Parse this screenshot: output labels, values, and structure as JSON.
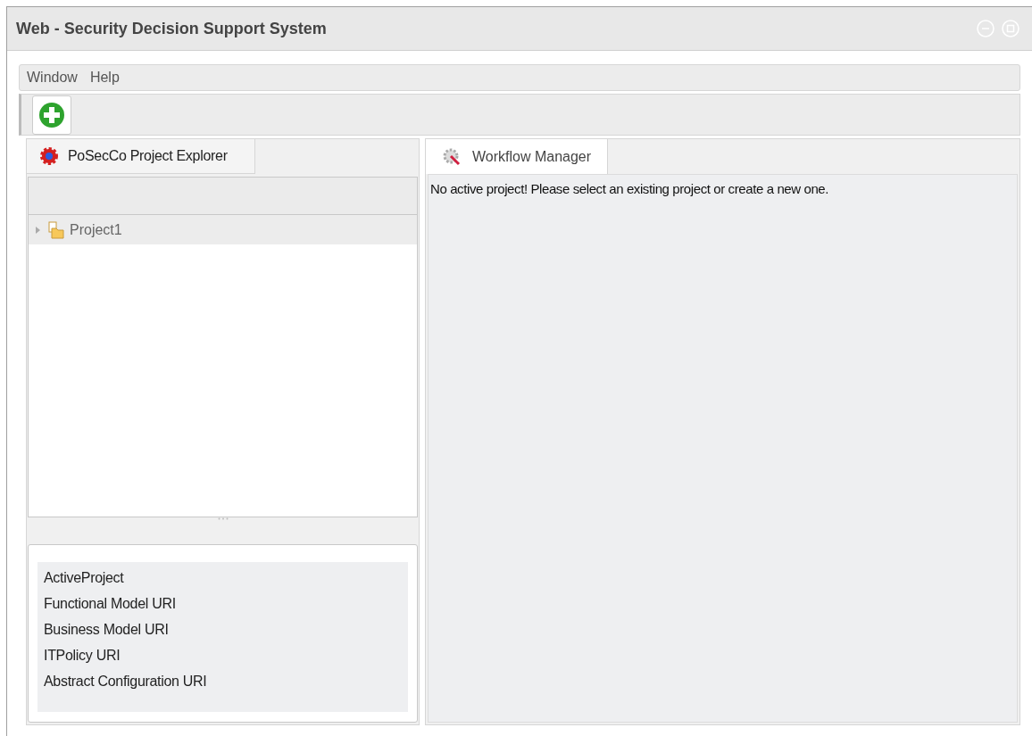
{
  "window": {
    "title": "Web - Security Decision Support System"
  },
  "menu": [
    "Window",
    "Help"
  ],
  "left_panel": {
    "tab": "PoSecCo Project Explorer",
    "tree": [
      {
        "label": "Project1",
        "expanded": false,
        "selected": true
      }
    ],
    "properties": [
      "ActiveProject",
      "Functional Model URI",
      "Business Model URI",
      "ITPolicy URI",
      "Abstract Configuration URI"
    ]
  },
  "right_panel": {
    "tab": "Workflow Manager",
    "message": "No active project! Please select an existing project or create a new one."
  }
}
